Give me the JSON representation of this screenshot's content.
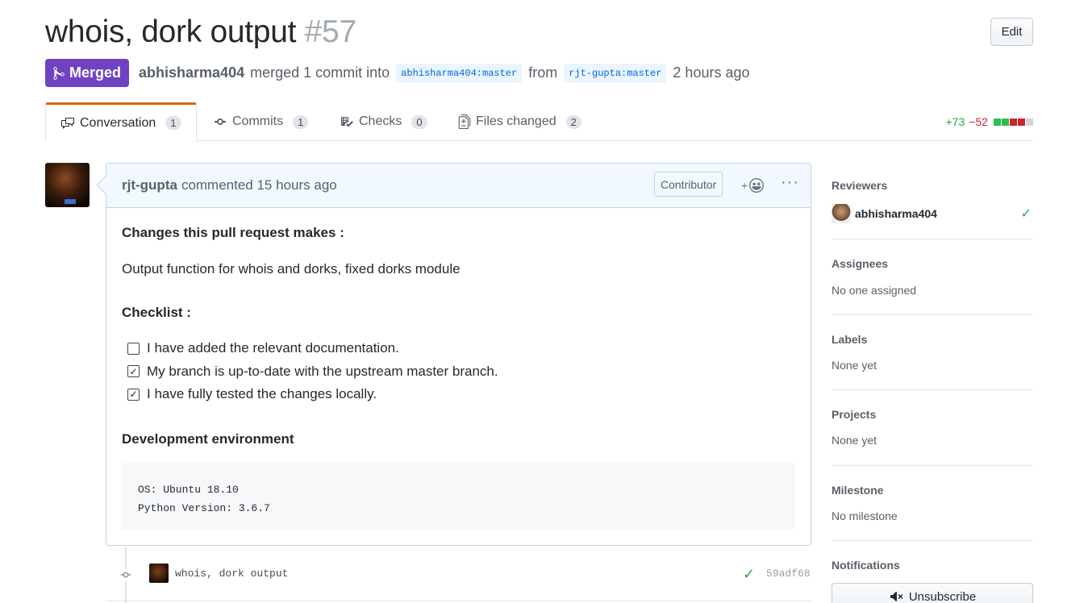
{
  "pr": {
    "title": "whois, dork output",
    "number": "#57",
    "edit_label": "Edit",
    "state_label": "Merged",
    "merged_by": "abhisharma404",
    "merged_text": "merged 1 commit into",
    "base_branch": "abhisharma404:master",
    "from_text": "from",
    "head_branch": "rjt-gupta:master",
    "time_ago": "2 hours ago"
  },
  "tabs": [
    {
      "label": "Conversation",
      "count": "1",
      "icon": "comment-discussion-icon"
    },
    {
      "label": "Commits",
      "count": "1",
      "icon": "git-commit-icon"
    },
    {
      "label": "Checks",
      "count": "0",
      "icon": "checklist-icon"
    },
    {
      "label": "Files changed",
      "count": "2",
      "icon": "file-diff-icon"
    }
  ],
  "diffstat": {
    "additions": "+73",
    "deletions": "−52",
    "blocks": [
      "#2cbe4e",
      "#2cbe4e",
      "#cb2431",
      "#cb2431",
      "#d1d5da"
    ]
  },
  "comment": {
    "author": "rjt-gupta",
    "action": "commented 15 hours ago",
    "role_badge": "Contributor",
    "heading": "Changes this pull request makes :",
    "description": "Output function for whois and dorks, fixed dorks module",
    "checklist_heading": "Checklist :",
    "tasks": [
      {
        "text": "I have added the relevant documentation.",
        "checked": false
      },
      {
        "text": "My branch is up-to-date with the upstream master branch.",
        "checked": true
      },
      {
        "text": "I have fully tested the changes locally.",
        "checked": true
      }
    ],
    "env_heading": "Development environment",
    "code_lines": [
      "OS: Ubuntu 18.10",
      "Python Version: 3.6.7"
    ]
  },
  "commit": {
    "message": "whois, dork output",
    "sha": "59adf68"
  },
  "sidebar": {
    "reviewers_label": "Reviewers",
    "reviewer": "abhisharma404",
    "assignees_label": "Assignees",
    "assignees_value": "No one assigned",
    "labels_label": "Labels",
    "labels_value": "None yet",
    "projects_label": "Projects",
    "projects_value": "None yet",
    "milestone_label": "Milestone",
    "milestone_value": "No milestone",
    "notifications_label": "Notifications",
    "unsubscribe_label": "Unsubscribe"
  },
  "colors": {
    "merged": "#6f42c1",
    "tab_accent": "#e36209",
    "additions": "#28a745",
    "deletions": "#cb2431",
    "comment_header_bg": "#f1f8ff"
  }
}
